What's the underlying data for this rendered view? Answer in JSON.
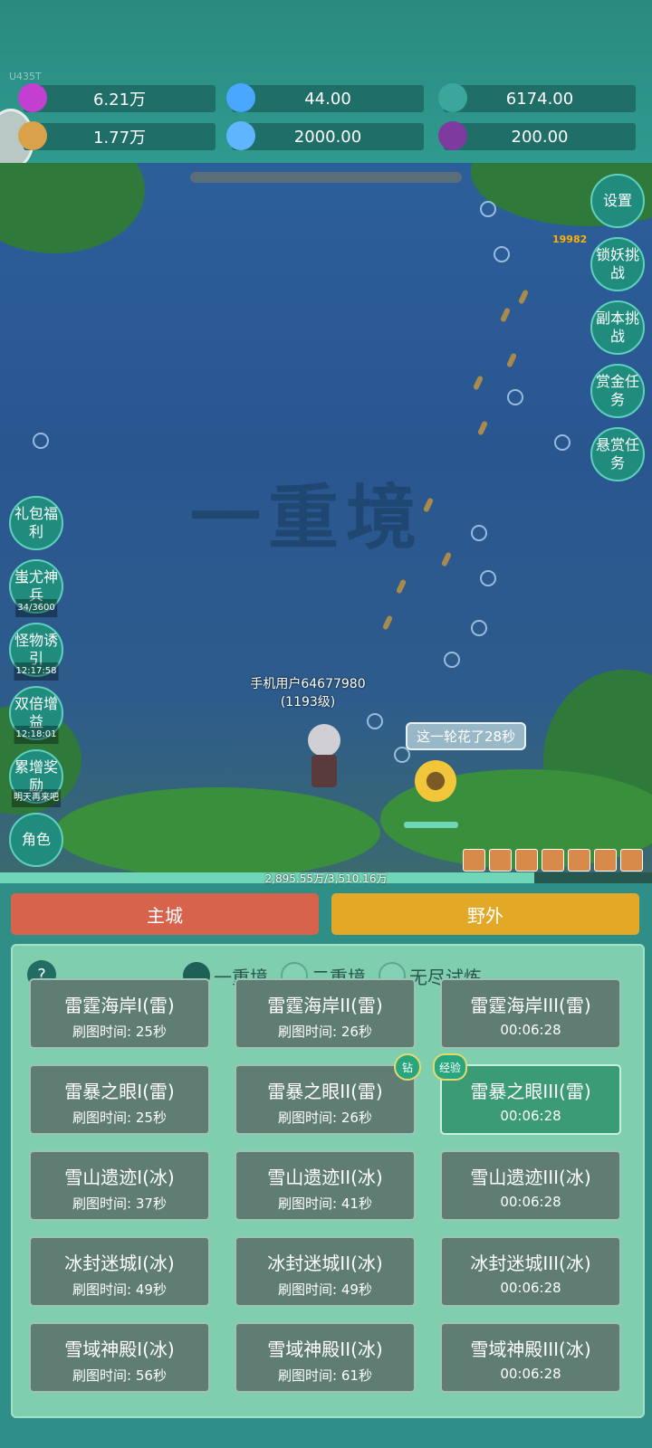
{
  "header": {
    "uid": "U435T",
    "resources": [
      {
        "icon": "purple-gem-icon",
        "value": "6.21万"
      },
      {
        "icon": "blue-crystal-icon",
        "value": "44.00"
      },
      {
        "icon": "teal-orb-icon",
        "value": "6174.00"
      },
      {
        "icon": "fish-icon",
        "value": "1.77万"
      },
      {
        "icon": "ice-shard-icon",
        "value": "2000.00"
      },
      {
        "icon": "purple-pouch-icon",
        "value": "200.00"
      }
    ]
  },
  "scene": {
    "damage": "19982",
    "watermark": "一重境",
    "player_name": "手机用户64677980",
    "player_level": "(1193级)",
    "tip": "这一轮花了28秒",
    "exp_text": "2,895.55万/3,510.16万",
    "exp_fraction": 0.82
  },
  "right_buttons": [
    "设置",
    "锁妖挑战",
    "副本挑战",
    "赏金任务",
    "悬赏任务"
  ],
  "left_buttons": [
    {
      "label": "礼包福利",
      "sub": ""
    },
    {
      "label": "蚩尤神兵",
      "sub": "34/3600"
    },
    {
      "label": "怪物诱引",
      "sub": "12:17:58"
    },
    {
      "label": "双倍增益",
      "sub": "12:18:01"
    },
    {
      "label": "累增奖励",
      "sub": "明天再来吧"
    },
    {
      "label": "角色",
      "sub": ""
    }
  ],
  "tabs": {
    "main_city": "主城",
    "wild": "野外"
  },
  "panel": {
    "help": "?",
    "radios": [
      "一重境",
      "二重境",
      "无尽试炼"
    ],
    "badges": [
      "钻",
      "经验"
    ],
    "cards": [
      {
        "name": "雷霆海岸I(雷)",
        "time": "刷图时间: 25秒"
      },
      {
        "name": "雷霆海岸II(雷)",
        "time": "刷图时间: 26秒"
      },
      {
        "name": "雷霆海岸III(雷)",
        "time": "00:06:28"
      },
      {
        "name": "雷暴之眼I(雷)",
        "time": "刷图时间: 25秒"
      },
      {
        "name": "雷暴之眼II(雷)",
        "time": "刷图时间: 26秒"
      },
      {
        "name": "雷暴之眼III(雷)",
        "time": "00:06:28"
      },
      {
        "name": "雪山遗迹I(冰)",
        "time": "刷图时间: 37秒"
      },
      {
        "name": "雪山遗迹II(冰)",
        "time": "刷图时间: 41秒"
      },
      {
        "name": "雪山遗迹III(冰)",
        "time": "00:06:28"
      },
      {
        "name": "冰封迷城I(冰)",
        "time": "刷图时间: 49秒"
      },
      {
        "name": "冰封迷城II(冰)",
        "time": "刷图时间: 49秒"
      },
      {
        "name": "冰封迷城III(冰)",
        "time": "00:06:28"
      },
      {
        "name": "雪域神殿I(冰)",
        "time": "刷图时间: 56秒"
      },
      {
        "name": "雪域神殿II(冰)",
        "time": "刷图时间: 61秒"
      },
      {
        "name": "雪域神殿III(冰)",
        "time": "00:06:28"
      }
    ]
  }
}
